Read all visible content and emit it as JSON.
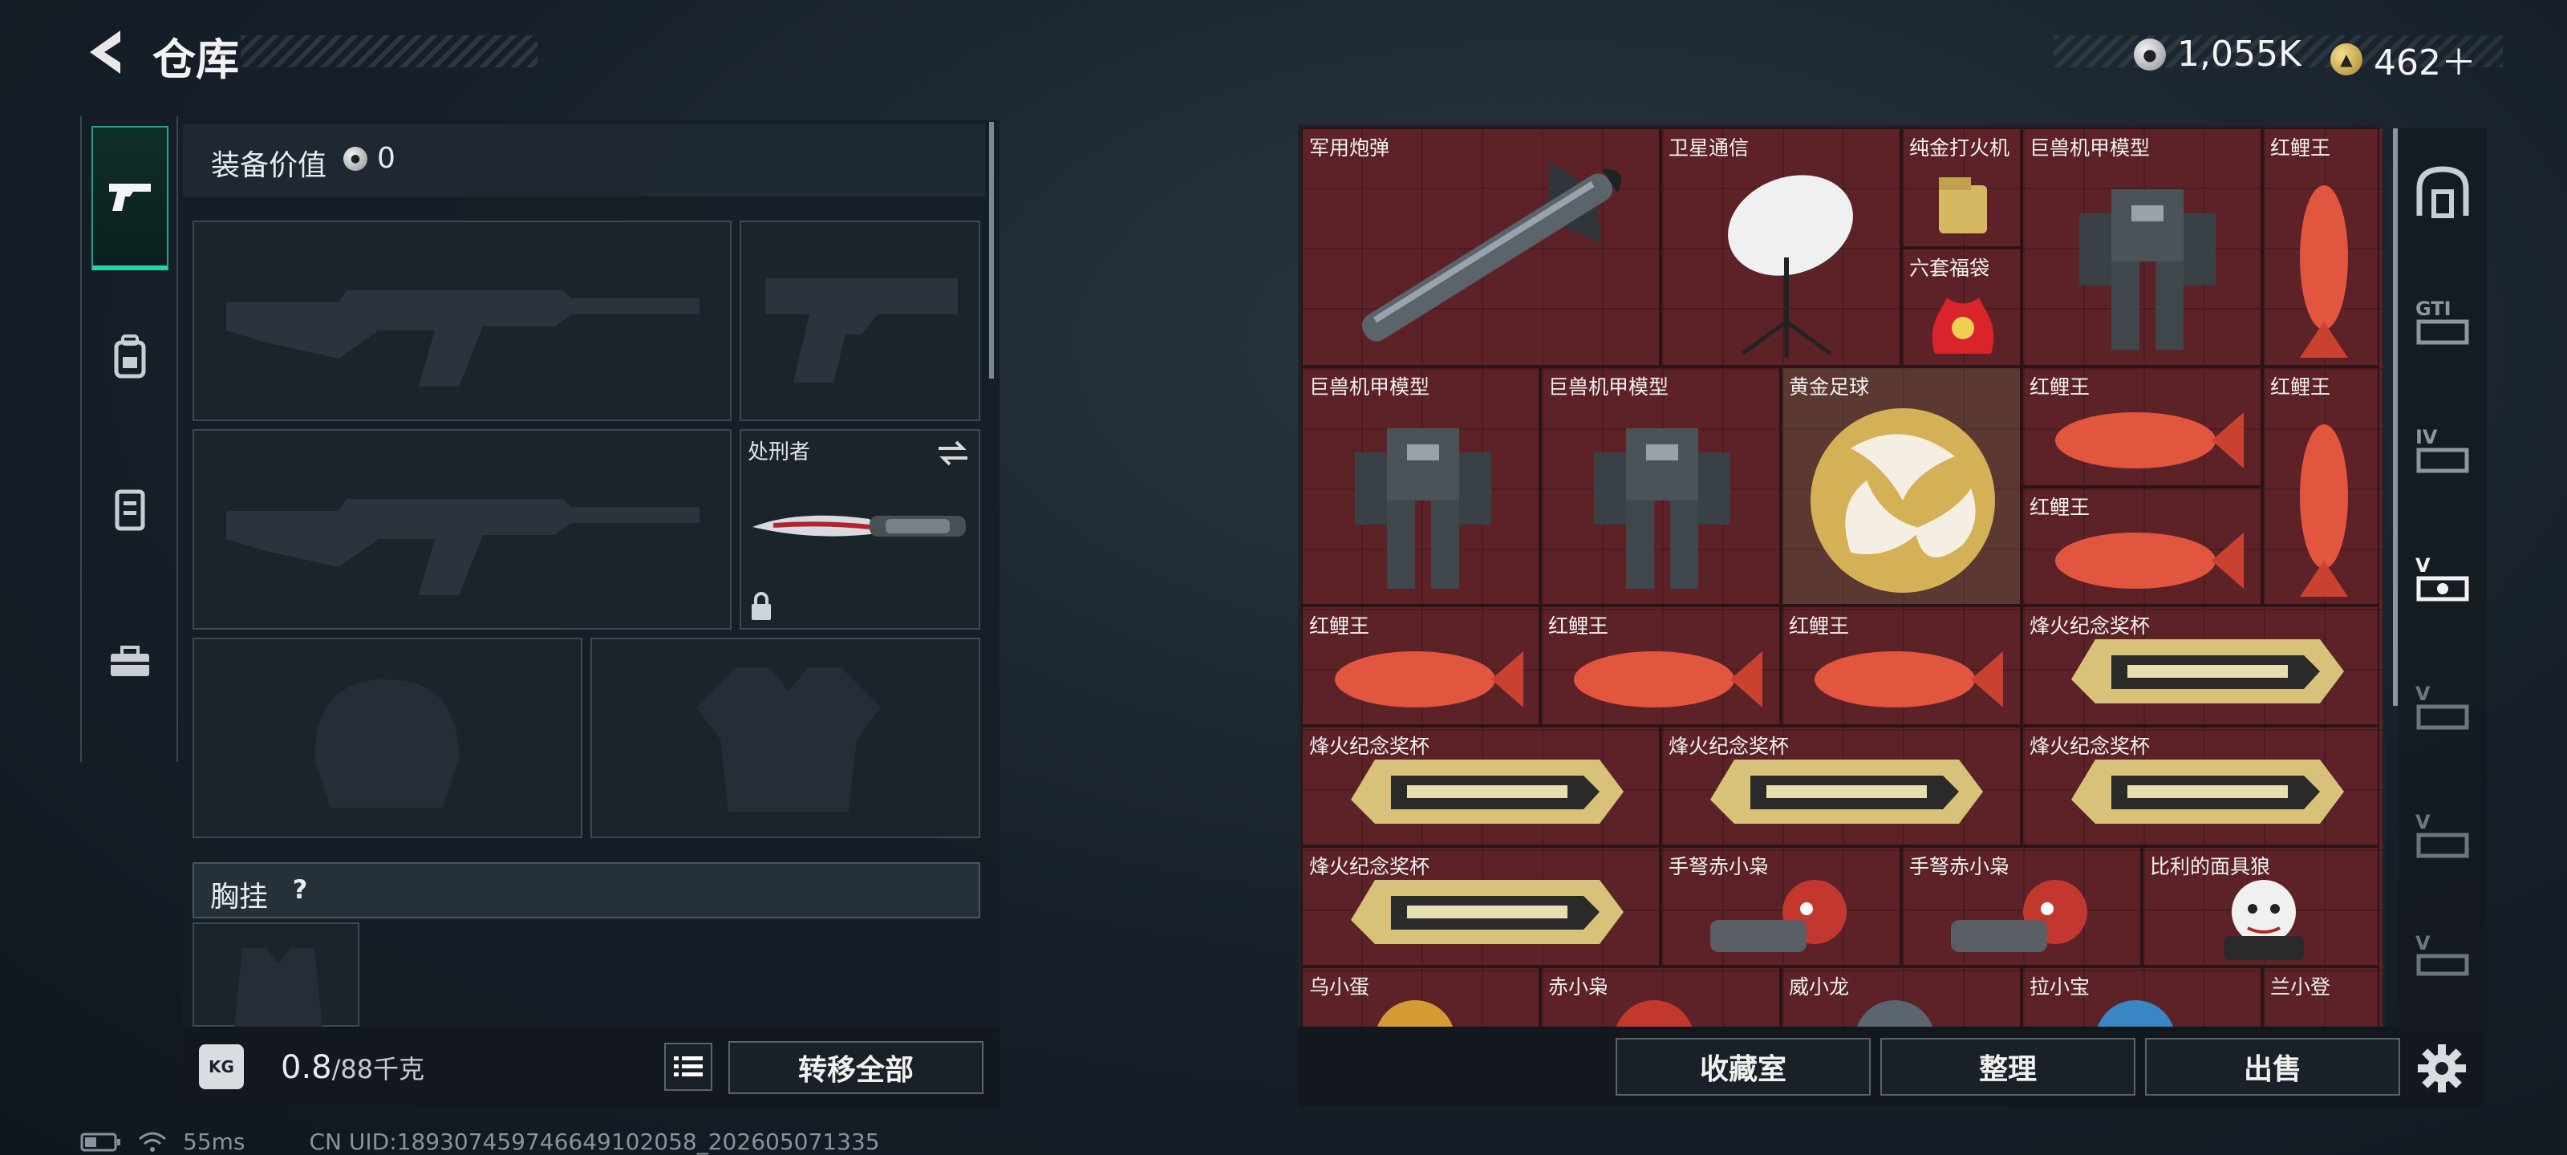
{
  "header": {
    "title": "仓库",
    "currencies": [
      {
        "icon": "silver-coin-icon",
        "value": "1,055K"
      },
      {
        "icon": "gold-coin-icon",
        "value": "462＋"
      }
    ]
  },
  "left_tabs": [
    {
      "icon": "pistol-icon",
      "active": true
    },
    {
      "icon": "backpack-icon",
      "active": false
    },
    {
      "icon": "chest-rig-icon",
      "active": false
    },
    {
      "icon": "toolbox-icon",
      "active": false
    }
  ],
  "equipment": {
    "value_label": "装备价值",
    "value": "0",
    "slots": {
      "rifle_1": {
        "label": ""
      },
      "pistol": {
        "label": ""
      },
      "rifle_2": {
        "label": ""
      },
      "knife": {
        "label": "处刑者"
      },
      "helmet": {
        "label": ""
      },
      "armor": {
        "label": ""
      }
    },
    "chest_rig_label": "胸挂",
    "chest_rig_help": "?"
  },
  "left_footer": {
    "weight_icon": "KG",
    "weight_current": "0.8",
    "weight_max": "/88千克",
    "transfer_all": "转移全部"
  },
  "storage": {
    "items": [
      {
        "name": "军用炮弹",
        "icon": "missile"
      },
      {
        "name": "卫星通信",
        "icon": "satellite-dish"
      },
      {
        "name": "纯金打火机",
        "icon": "lighter"
      },
      {
        "name": "六套福袋",
        "icon": "lucky-bag"
      },
      {
        "name": "巨兽机甲模型",
        "icon": "mech"
      },
      {
        "name": "红鲤王",
        "icon": "carp-vertical"
      },
      {
        "name": "巨兽机甲模型",
        "icon": "mech"
      },
      {
        "name": "巨兽机甲模型",
        "icon": "mech"
      },
      {
        "name": "黄金足球",
        "icon": "golden-ball"
      },
      {
        "name": "红鲤王",
        "icon": "carp"
      },
      {
        "name": "红鲤王",
        "icon": "carp"
      },
      {
        "name": "红鲤王",
        "icon": "carp-vertical"
      },
      {
        "name": "红鲤王",
        "icon": "carp"
      },
      {
        "name": "红鲤王",
        "icon": "carp"
      },
      {
        "name": "红鲤王",
        "icon": "carp"
      },
      {
        "name": "烽火纪念奖杯",
        "icon": "trophy"
      },
      {
        "name": "烽火纪念奖杯",
        "icon": "trophy"
      },
      {
        "name": "烽火纪念奖杯",
        "icon": "trophy"
      },
      {
        "name": "烽火纪念奖杯",
        "icon": "trophy"
      },
      {
        "name": "烽火纪念奖杯",
        "icon": "trophy"
      },
      {
        "name": "手弩赤小枭",
        "icon": "figure"
      },
      {
        "name": "手弩赤小枭",
        "icon": "figure"
      },
      {
        "name": "比利的面具狼",
        "icon": "figure"
      },
      {
        "name": "乌小蛋",
        "icon": "figure"
      },
      {
        "name": "赤小枭",
        "icon": "figure"
      },
      {
        "name": "威小龙",
        "icon": "figure"
      },
      {
        "name": "拉小宝",
        "icon": "figure"
      },
      {
        "name": "兰小登",
        "icon": "figure"
      }
    ]
  },
  "right_rail": [
    {
      "icon": "safe-house-icon"
    },
    {
      "icon": "gti-stash-icon"
    },
    {
      "icon": "iv-stash-icon"
    },
    {
      "icon": "v-stash-icon-active"
    },
    {
      "icon": "v-stash-icon"
    },
    {
      "icon": "v-stash-icon"
    },
    {
      "icon": "v-stash-icon"
    },
    {
      "icon": "settings-gear-icon"
    }
  ],
  "right_footer": {
    "collection": "收藏室",
    "organize": "整理",
    "sell": "出售"
  },
  "status_bar": {
    "ping": "55ms",
    "uid": "CN UID:18930745974664910205​8_202605071335"
  },
  "colors": {
    "accent": "#26d3a5",
    "storage_bg": "#5c2228"
  }
}
